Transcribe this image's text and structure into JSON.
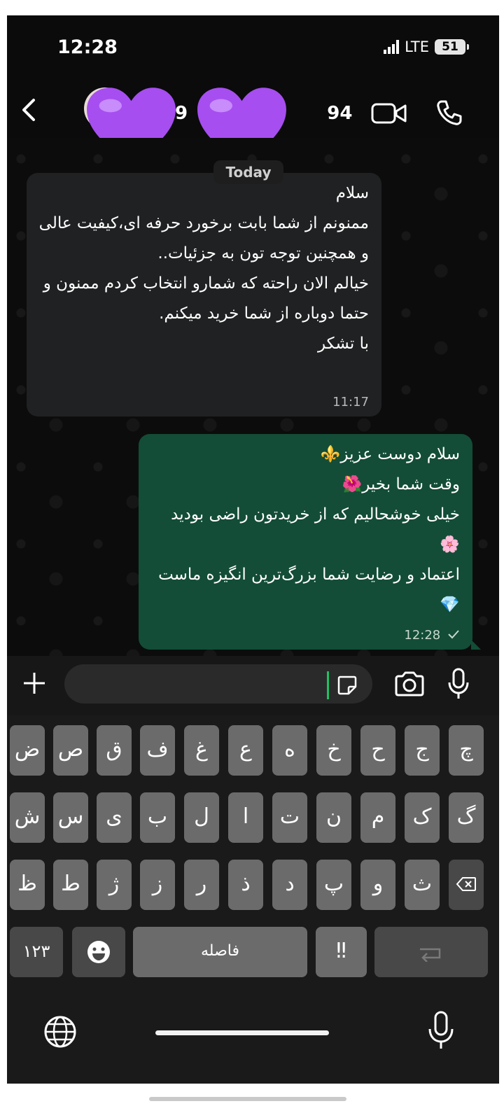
{
  "status_bar": {
    "time": "12:28",
    "network": "LTE",
    "battery": "51"
  },
  "header": {
    "contact_name": "9                      94",
    "heart_color": "#a64ef0"
  },
  "chat": {
    "date_chip": "Today",
    "messages": [
      {
        "direction": "incoming",
        "text": "سلام\nممنونم از شما بابت برخورد حرفه ای،کیفیت عالی و همچنین توجه تون به جزئیات..\nخیالم الان راحته که شمارو انتخاب کردم ممنون و حتما دوباره از شما خرید میکنم.\nبا تشکر",
        "time": "11:17"
      },
      {
        "direction": "outgoing",
        "text": "سلام دوست عزیز⚜️\nوقت شما بخیر🌺\nخیلی خوشحالیم که از خریدتون راضی بودید 🌸\nاعتماد و رضایت شما بزرگ‌ترین انگیزه ماست 💎",
        "time": "12:28"
      }
    ]
  },
  "input": {
    "placeholder": ""
  },
  "keyboard": {
    "row1": [
      "ض",
      "ص",
      "ق",
      "ف",
      "غ",
      "ع",
      "ه",
      "خ",
      "ح",
      "ج",
      "چ"
    ],
    "row2": [
      "ش",
      "س",
      "ی",
      "ب",
      "ل",
      "ا",
      "ت",
      "ن",
      "م",
      "ک",
      "گ"
    ],
    "row3": [
      "ظ",
      "ط",
      "ژ",
      "ز",
      "ر",
      "ذ",
      "د",
      "پ",
      "و",
      "ث"
    ],
    "num_key": "۱۲۳",
    "space_key": "فاصله",
    "punct_key": "‼"
  },
  "colors": {
    "bubble_out": "#134d37",
    "bubble_in": "#1f2122",
    "accent": "#21c063"
  }
}
